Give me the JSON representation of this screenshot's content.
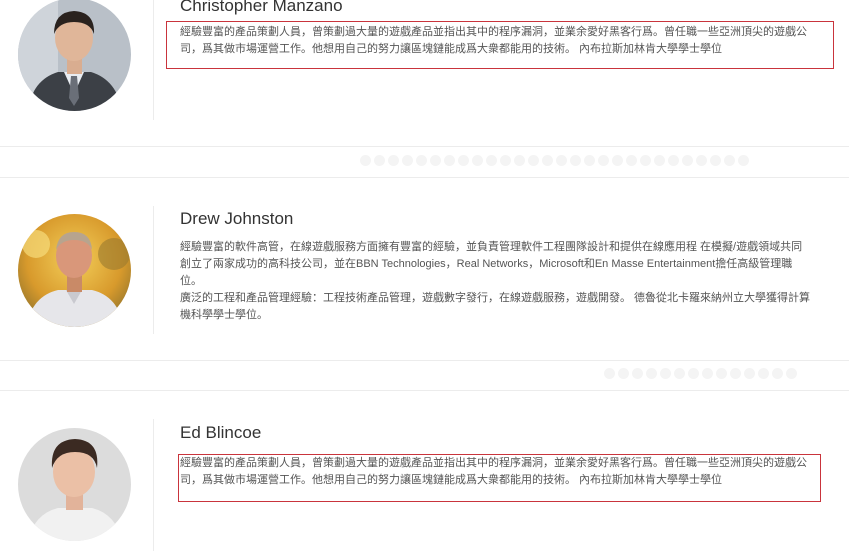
{
  "members": [
    {
      "name": "Christopher Manzano",
      "bio": [
        "經驗豐富的產品策劃人員，曾策劃過大量的遊戲產品並指出其中的程序漏洞，並業余愛好黑客行爲。曾任職一些亞洲頂尖的遊戲公司，爲其做市場運營工作。他想用自己的努力讓區塊鏈能成爲大衆都能用的技術。 內布拉斯加林肯大學學士學位"
      ],
      "highlighted": true
    },
    {
      "name": "Drew Johnston",
      "bio": [
        "經驗豐富的軟件高管，在線遊戲服務方面擁有豐富的經驗，並負責管理軟件工程團隊設計和提供在線應用程 在模擬/遊戲領域共同創立了兩家成功的高科技公司，並在BBN Technologies，Real Networks，Microsoft和En Masse Entertainment擔任高級管理職位。",
        "廣泛的工程和產品管理經驗：工程技術產品管理，遊戲數字發行，在線遊戲服務，遊戲開發。 德魯從北卡羅來納州立大學獲得計算機科學學士學位。"
      ],
      "highlighted": false
    },
    {
      "name": "Ed Blincoe",
      "bio": [
        "經驗豐富的產品策劃人員，曾策劃過大量的遊戲產品並指出其中的程序漏洞，並業余愛好黑客行爲。曾任職一些亞洲頂尖的遊戲公司，爲其做市場運營工作。他想用自己的努力讓區塊鏈能成爲大衆都能用的技術。 內布拉斯加林肯大學學士學位"
      ],
      "highlighted": true
    }
  ],
  "colors": {
    "highlight_border": "#c9343c",
    "name_text": "#333333",
    "bio_text": "#555555",
    "divider": "#ececec"
  }
}
